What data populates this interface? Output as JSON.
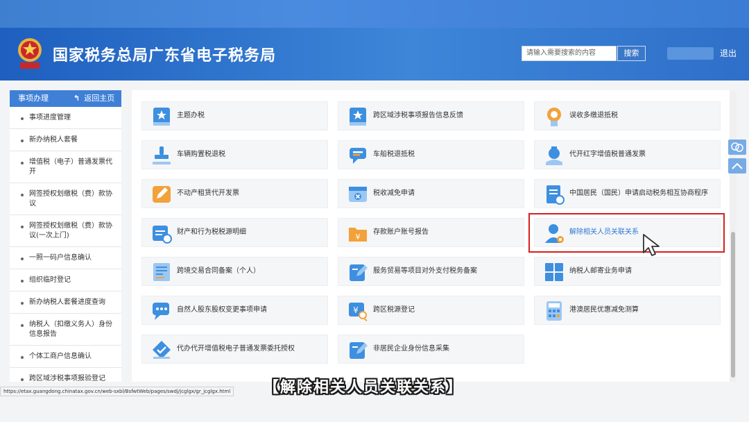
{
  "header": {
    "site_title": "国家税务总局广东省电子税务局",
    "search_placeholder": "请输入需要搜索的内容",
    "search_button": "搜索",
    "logout": "退出"
  },
  "sidebar": {
    "title": "事项办理",
    "back_link": "返回主页",
    "items": [
      {
        "label": "事项进度管理"
      },
      {
        "label": "新办纳税人套餐"
      },
      {
        "label": "增值税（电子）普通发票代开"
      },
      {
        "label": "网签授权划缴税（费）款协议"
      },
      {
        "label": "网签授权划缴税（费）款协议(一次上门)"
      },
      {
        "label": "一照一码户信息确认"
      },
      {
        "label": "组织临时登记"
      },
      {
        "label": "新办纳税人套餐进度查询"
      },
      {
        "label": "纳税人（扣缴义务人）身份信息报告"
      },
      {
        "label": "个体工商户信息确认"
      },
      {
        "label": "跨区域涉税事项报验登记"
      }
    ]
  },
  "tiles": [
    {
      "label": "主题办税",
      "icon": "star-book-icon"
    },
    {
      "label": "跨区域涉税事项报告信息反馈",
      "icon": "star-book-icon"
    },
    {
      "label": "误收多缴退抵税",
      "icon": "medal-icon"
    },
    {
      "label": "车辆购置税退税",
      "icon": "stamp-icon"
    },
    {
      "label": "车船税退抵税",
      "icon": "chat-bubble-icon"
    },
    {
      "label": "代开红字增值税普通发票",
      "icon": "money-bag-icon"
    },
    {
      "label": "不动产租赁代开发票",
      "icon": "pencil-icon"
    },
    {
      "label": "税收减免申请",
      "icon": "dialog-x-icon"
    },
    {
      "label": "中国居民（国民）申请启动税务相互协商程序",
      "icon": "document-clock-icon"
    },
    {
      "label": "财产和行为税税源明细",
      "icon": "calendar-clock-icon"
    },
    {
      "label": "存款账户账号报告",
      "icon": "yen-folder-icon"
    },
    {
      "label": "解除相关人员关联关系",
      "icon": "user-gear-icon"
    },
    {
      "label": "跨境交易合同备案（个人）",
      "icon": "contract-icon"
    },
    {
      "label": "服务贸易等项目对外支付税务备案",
      "icon": "pen-document-icon"
    },
    {
      "label": "纳税人邮寄业务申请",
      "icon": "grid-icon"
    },
    {
      "label": "自然人股东股权变更事项申请",
      "icon": "chat-dots-icon"
    },
    {
      "label": "跨区税源登记",
      "icon": "yen-search-icon"
    },
    {
      "label": "港澳居民优惠减免测算",
      "icon": "calculator-icon"
    },
    {
      "label": "代办代开增值税电子普通发票委托授权",
      "icon": "check-diamond-icon"
    },
    {
      "label": "非居民企业身份信息采集",
      "icon": "pen-document-icon"
    }
  ],
  "status_url": "https://etax.guangdong.chinatax.gov.cn/web-sxbl/BsfwtWeb/pages/swdj/jcglgx/gr_jcglgx.html",
  "caption": "【解除相关人员关联关系】",
  "colors": {
    "header_blue": "#2f6fc9",
    "sidebar_head": "#3f80d6",
    "highlight_red": "#d71e1e",
    "link_blue": "#2e7bd4"
  }
}
